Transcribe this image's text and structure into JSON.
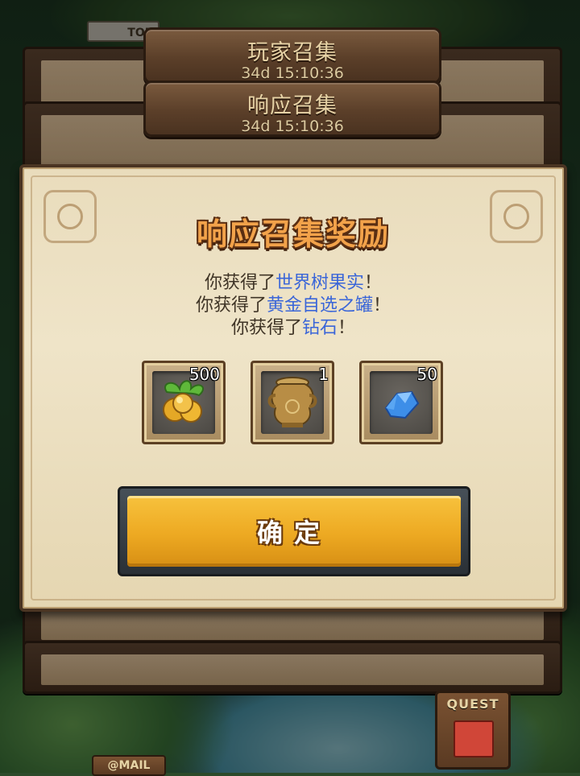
{
  "background": {
    "top_tag": "TOP",
    "quest_label": "QUEST",
    "mail_label": "@MAIL"
  },
  "panels": [
    {
      "title": "玩家召集",
      "timer": "34d 15:10:36"
    },
    {
      "title": "响应召集",
      "timer": "34d 15:10:36"
    }
  ],
  "dialog": {
    "title": "响应召集奖励",
    "lines": [
      {
        "prefix": "你获得了",
        "item": "世界树果实",
        "suffix": "！"
      },
      {
        "prefix": "你获得了",
        "item": "黄金自选之罐",
        "suffix": "！"
      },
      {
        "prefix": "你获得了",
        "item": "钻石",
        "suffix": "！"
      }
    ],
    "rewards": [
      {
        "icon": "world-tree-fruit-icon",
        "count": "500"
      },
      {
        "icon": "golden-jar-icon",
        "count": "1"
      },
      {
        "icon": "diamond-icon",
        "count": "50"
      }
    ],
    "confirm_label": "确定"
  },
  "colors": {
    "highlight": "#3b66d8",
    "title_orange": "#f2a24a",
    "button_gold": "#eda922"
  }
}
